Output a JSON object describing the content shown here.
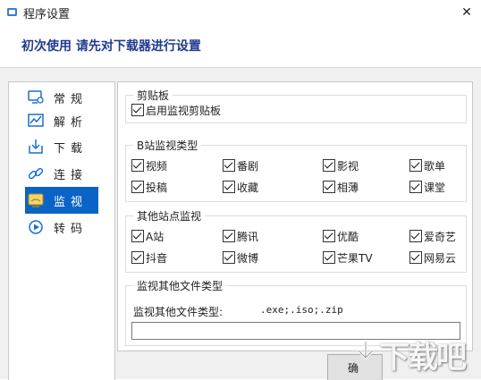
{
  "window": {
    "title": "程序设置",
    "close_glyph": "✕"
  },
  "banner": {
    "text": "初次使用 请先对下载器进行设置",
    "color": "#1f3a8f"
  },
  "sidebar": {
    "items": [
      {
        "label": "常规",
        "icon": "monitor-settings-icon",
        "selected": false
      },
      {
        "label": "解析",
        "icon": "chart-icon",
        "selected": false
      },
      {
        "label": "下载",
        "icon": "download-icon",
        "selected": false
      },
      {
        "label": "连接",
        "icon": "link-icon",
        "selected": false
      },
      {
        "label": "监视",
        "icon": "monitor-icon",
        "selected": true
      },
      {
        "label": "转码",
        "icon": "play-circle-icon",
        "selected": false
      }
    ],
    "selected_color": "#0a64c8"
  },
  "clipboard": {
    "title": "剪贴板",
    "items": [
      {
        "label": "启用监视剪贴板",
        "checked": true
      }
    ]
  },
  "bilibili": {
    "title": "B站监视类型",
    "items": [
      {
        "label": "视频",
        "checked": true
      },
      {
        "label": "番剧",
        "checked": true
      },
      {
        "label": "影视",
        "checked": true
      },
      {
        "label": "歌单",
        "checked": true
      },
      {
        "label": "投稿",
        "checked": true
      },
      {
        "label": "收藏",
        "checked": true
      },
      {
        "label": "相薄",
        "checked": true
      },
      {
        "label": "课堂",
        "checked": true
      }
    ]
  },
  "other_sites": {
    "title": "其他站点监视",
    "items": [
      {
        "label": "A站",
        "checked": true
      },
      {
        "label": "腾讯",
        "checked": true
      },
      {
        "label": "优酷",
        "checked": true
      },
      {
        "label": "爱奇艺",
        "checked": true
      },
      {
        "label": "抖音",
        "checked": true
      },
      {
        "label": "微博",
        "checked": true
      },
      {
        "label": "芒果TV",
        "checked": true
      },
      {
        "label": "网易云",
        "checked": true
      }
    ]
  },
  "other_files": {
    "title": "监视其他文件类型",
    "label": "监视其他文件类型:",
    "value": ".exe;.iso;.zip",
    "input_value": ""
  },
  "buttons": {
    "ok_label": "确"
  },
  "watermark": {
    "text": "下载吧"
  }
}
